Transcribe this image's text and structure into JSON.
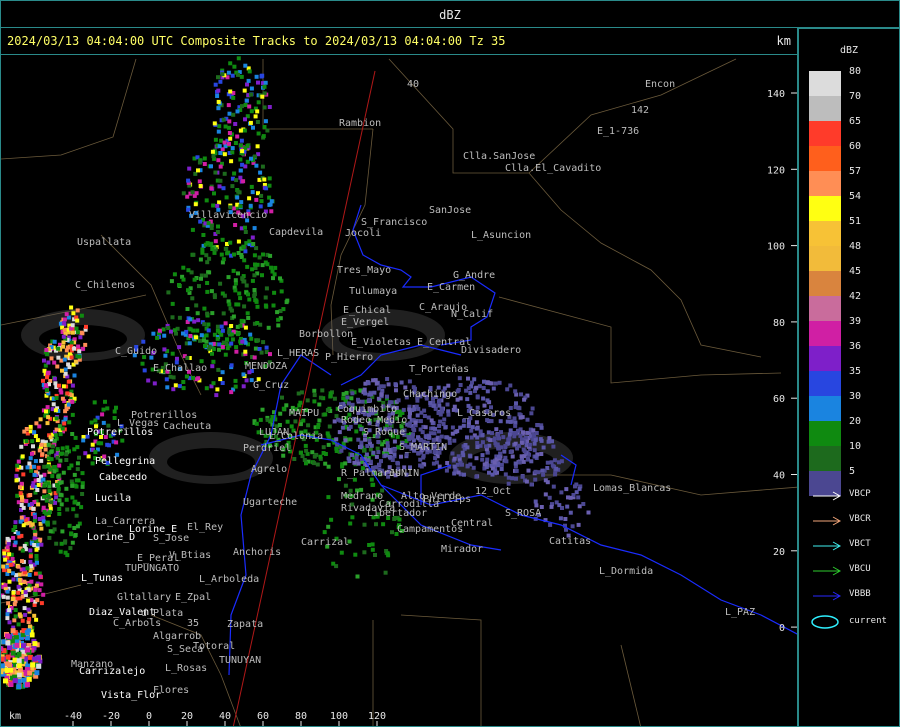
{
  "window": {
    "title": "dBZ"
  },
  "header": {
    "caption": "2024/03/13 04:04:00 UTC Composite Tracks to 2024/03/13 04:04:00 Tz 35",
    "unit": "km"
  },
  "axes": {
    "y_unit": "km",
    "x_unit": "km",
    "x_ticks": [
      "-40",
      "-20",
      "0",
      "20",
      "40",
      "60",
      "80",
      "100",
      "120"
    ],
    "y_ticks": [
      "140",
      "120",
      "100",
      "80",
      "60",
      "40",
      "20",
      "0"
    ]
  },
  "legend": {
    "title": "dBZ",
    "levels": [
      {
        "value": "80",
        "color": "#dcdcdc"
      },
      {
        "value": "70",
        "color": "#bdbdbd"
      },
      {
        "value": "65",
        "color": "#ff3b2a"
      },
      {
        "value": "60",
        "color": "#ff5f1c"
      },
      {
        "value": "57",
        "color": "#ff8e55"
      },
      {
        "value": "54",
        "color": "#ffff12"
      },
      {
        "value": "51",
        "color": "#f7c236"
      },
      {
        "value": "48",
        "color": "#f2bb3a"
      },
      {
        "value": "45",
        "color": "#d9843e"
      },
      {
        "value": "42",
        "color": "#c96c9c"
      },
      {
        "value": "39",
        "color": "#d01fa4"
      },
      {
        "value": "36",
        "color": "#7e1fc9"
      },
      {
        "value": "35",
        "color": "#2846e0"
      },
      {
        "value": "30",
        "color": "#1a84e0"
      },
      {
        "value": "20",
        "color": "#0f8a10"
      },
      {
        "value": "10",
        "color": "#1d6a1d"
      },
      {
        "value": "5",
        "color": "#4b4791"
      }
    ],
    "tracks": [
      {
        "label": "VBCP",
        "color": "#ffffff"
      },
      {
        "label": "VBCR",
        "color": "#f2a67a"
      },
      {
        "label": "VBCT",
        "color": "#3ff0f0"
      },
      {
        "label": "VBCU",
        "color": "#2ecc2e"
      },
      {
        "label": "VBBB",
        "color": "#2828ff"
      }
    ],
    "current": {
      "label": "current",
      "color": "#2ff0ff"
    }
  },
  "places_white": [
    "Potrerillos",
    "Pellegrina",
    "Cabecedo",
    "Lucila",
    "Lorine_D",
    "Lorine_E",
    "L_Tunas",
    "Diaz_Valent",
    "Carrizalejo",
    "Vista_Flor"
  ],
  "places_gray": [
    "Encon",
    "Rambion",
    "E_1-736",
    "Clla.SanJose",
    "Clla.El_Cavadito",
    "SanJose",
    "S_Francisco",
    "Jocoli",
    "L_Asuncion",
    "Uspallata",
    "Villavicencio",
    "Capdevila",
    "C_Chilenos",
    "Tres_Mayo",
    "G_Andre",
    "Tulumaya",
    "E_Carmen",
    "E_Chical",
    "E_Vergel",
    "C_Araujo",
    "N_Calif",
    "Borbollon",
    "E_Violetas",
    "E_Central",
    "C_Guido",
    "P_Hierro",
    "Divisadero",
    "MENDOZA",
    "L_HERAS",
    "E_Challao",
    "T_Porteñas",
    "G_Cruz",
    "Potrerillos",
    "Chachingo",
    "L_Vegas",
    "Cacheuta",
    "LUJAN",
    "MAIPU",
    "Coquimbito",
    "Rodeo_Medio",
    "L_Casaros",
    "S_Roque",
    "L_Colonia",
    "Perdriel",
    "S_MARTIN",
    "Agrelo",
    "R_Palmares",
    "JUNIN",
    "Alto_Verde",
    "Ugarteche",
    "Medrano",
    "Rivadavia",
    "Phillips",
    "Lomas_Blancas",
    "12_Oct",
    "La_Carrera",
    "Carrodilla",
    "Libertador",
    "Central",
    "S_ROSA",
    "El_Rey",
    "S_Jose",
    "Carrizal",
    "Campamentos",
    "Catitas",
    "E_Peral",
    "V_Btias",
    "Anchoris",
    "Mirador",
    "TUPUNGATO",
    "L_Arboleda",
    "L_Dormida",
    "Gltallary",
    "E_Zpal",
    "d_Plata",
    "C_Arbols",
    "Zapata",
    "L_PAZ",
    "Algarrob",
    "S_Seca",
    "Totoral",
    "Manzano",
    "TUNUYAN",
    "L_Rosas",
    "Flores",
    "142",
    "40",
    "35"
  ]
}
